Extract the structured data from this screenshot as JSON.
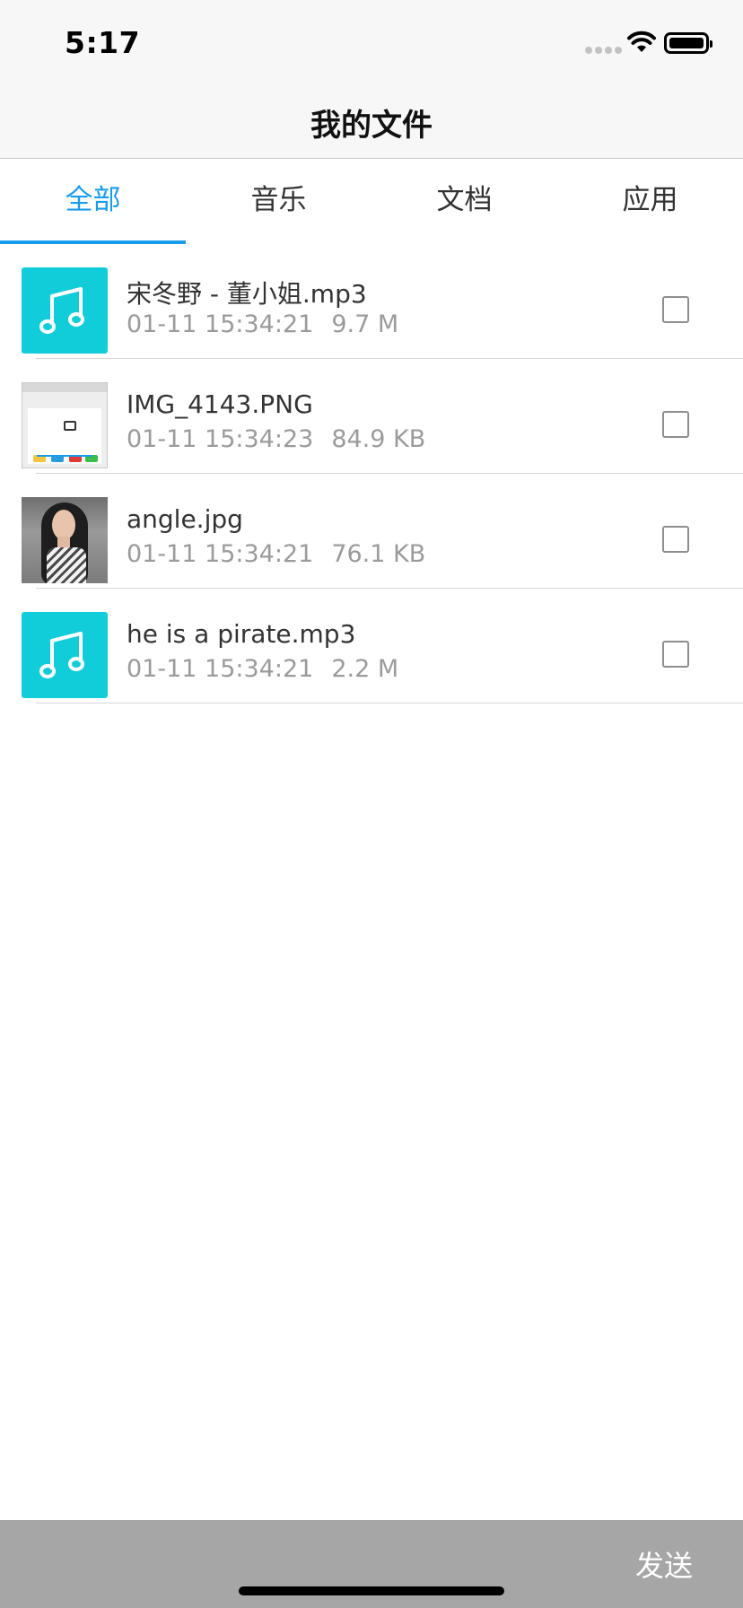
{
  "status_bar": {
    "time": "5:17"
  },
  "nav": {
    "title": "我的文件"
  },
  "tabs": [
    {
      "label": "全部",
      "active": true
    },
    {
      "label": "音乐",
      "active": false
    },
    {
      "label": "文档",
      "active": false
    },
    {
      "label": "应用",
      "active": false
    }
  ],
  "files": [
    {
      "name": "宋冬野 - 董小姐.mp3",
      "date": "01-11 15:34:21",
      "size": "9.7 M",
      "thumb": "music-note-icon",
      "checked": false
    },
    {
      "name": "IMG_4143.PNG",
      "date": "01-11 15:34:23",
      "size": "84.9 KB",
      "thumb": "screenshot-thumbnail",
      "checked": false
    },
    {
      "name": "angle.jpg",
      "date": "01-11 15:34:21",
      "size": "76.1 KB",
      "thumb": "portrait-photo-thumbnail",
      "checked": false
    },
    {
      "name": "he is a pirate.mp3",
      "date": "01-11 15:34:21",
      "size": "2.2 M",
      "thumb": "music-note-icon",
      "checked": false
    }
  ],
  "bottom_bar": {
    "send_label": "发送"
  },
  "colors": {
    "accent": "#1a9de8",
    "music_tile": "#11cdd9",
    "bottom_bar": "#a6a6a6"
  }
}
